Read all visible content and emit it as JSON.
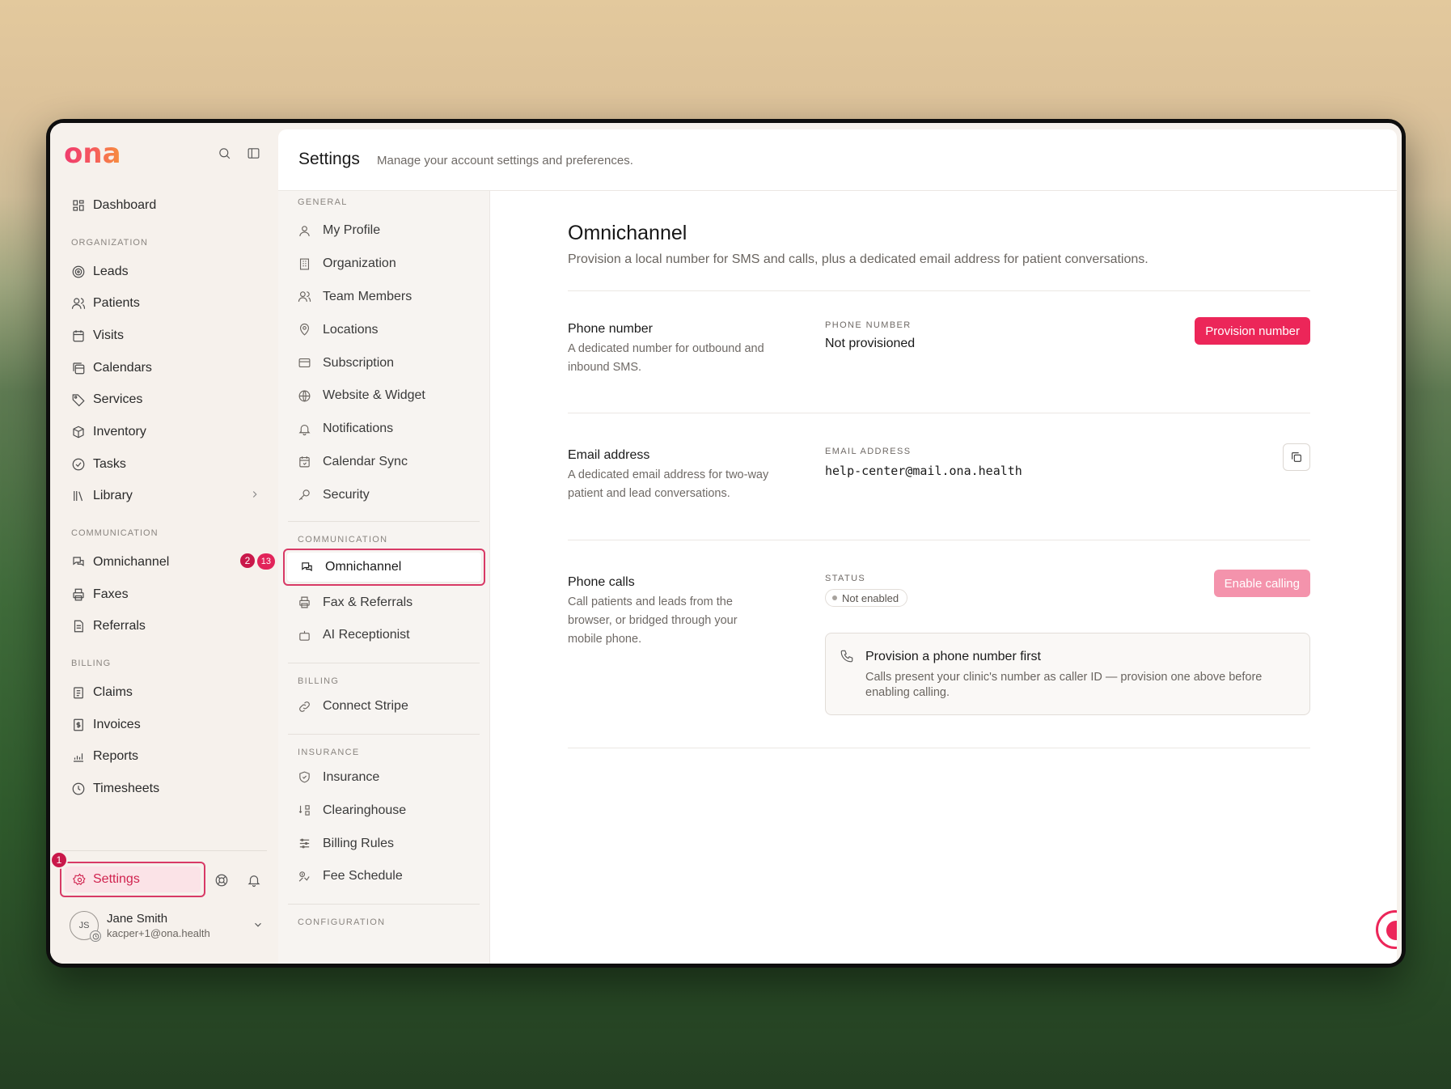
{
  "brand": {
    "logo": "ona",
    "accent": "#ec2659"
  },
  "sidebar": {
    "dashboard": "Dashboard",
    "sections": [
      {
        "title": "ORGANIZATION",
        "items": [
          {
            "label": "Leads",
            "icon": "target-icon"
          },
          {
            "label": "Patients",
            "icon": "users-icon"
          },
          {
            "label": "Visits",
            "icon": "calendar-icon"
          },
          {
            "label": "Calendars",
            "icon": "calendars-icon"
          },
          {
            "label": "Services",
            "icon": "tag-icon"
          },
          {
            "label": "Inventory",
            "icon": "box-icon"
          },
          {
            "label": "Tasks",
            "icon": "check-circle-icon"
          },
          {
            "label": "Library",
            "icon": "library-icon",
            "has_chevron": true
          }
        ]
      },
      {
        "title": "COMMUNICATION",
        "items": [
          {
            "label": "Omnichannel",
            "icon": "chat-icon",
            "badge": "13"
          },
          {
            "label": "Faxes",
            "icon": "printer-icon"
          },
          {
            "label": "Referrals",
            "icon": "document-icon"
          }
        ]
      },
      {
        "title": "BILLING",
        "items": [
          {
            "label": "Claims",
            "icon": "clipboard-icon"
          },
          {
            "label": "Invoices",
            "icon": "invoice-icon"
          },
          {
            "label": "Reports",
            "icon": "chart-icon"
          },
          {
            "label": "Timesheets",
            "icon": "clock-icon"
          }
        ]
      }
    ],
    "settings_label": "Settings",
    "user": {
      "initials": "JS",
      "name": "Jane Smith",
      "email": "kacper+1@ona.health"
    }
  },
  "annotations": {
    "step1": "1",
    "step2": "2"
  },
  "header": {
    "title": "Settings",
    "subtitle": "Manage your account settings and preferences."
  },
  "subnav": {
    "general_title": "GENERAL",
    "general": [
      "My Profile",
      "Organization",
      "Team Members",
      "Locations",
      "Subscription",
      "Website & Widget",
      "Notifications",
      "Calendar Sync",
      "Security"
    ],
    "communication_title": "COMMUNICATION",
    "communication_active": "Omnichannel",
    "communication": [
      "Fax & Referrals",
      "AI Receptionist"
    ],
    "billing_title": "BILLING",
    "billing": [
      "Connect Stripe"
    ],
    "insurance_title": "INSURANCE",
    "insurance": [
      "Insurance",
      "Clearinghouse",
      "Billing Rules",
      "Fee Schedule"
    ],
    "configuration_title": "CONFIGURATION"
  },
  "content": {
    "title": "Omnichannel",
    "subtitle": "Provision a local number for SMS and calls, plus a dedicated email address for patient conversations.",
    "phone": {
      "label": "Phone number",
      "desc": "A dedicated number for outbound and inbound SMS.",
      "caption": "PHONE NUMBER",
      "value": "Not provisioned",
      "button": "Provision number"
    },
    "email": {
      "label": "Email address",
      "desc": "A dedicated email address for two-way patient and lead conversations.",
      "caption": "EMAIL ADDRESS",
      "value": "help-center@mail.ona.health"
    },
    "calls": {
      "label": "Phone calls",
      "desc": "Call patients and leads from the browser, or bridged through your mobile phone.",
      "caption": "STATUS",
      "status": "Not enabled",
      "button": "Enable calling",
      "info_title": "Provision a phone number first",
      "info_text": "Calls present your clinic's number as caller ID — provision one above before enabling calling."
    }
  }
}
